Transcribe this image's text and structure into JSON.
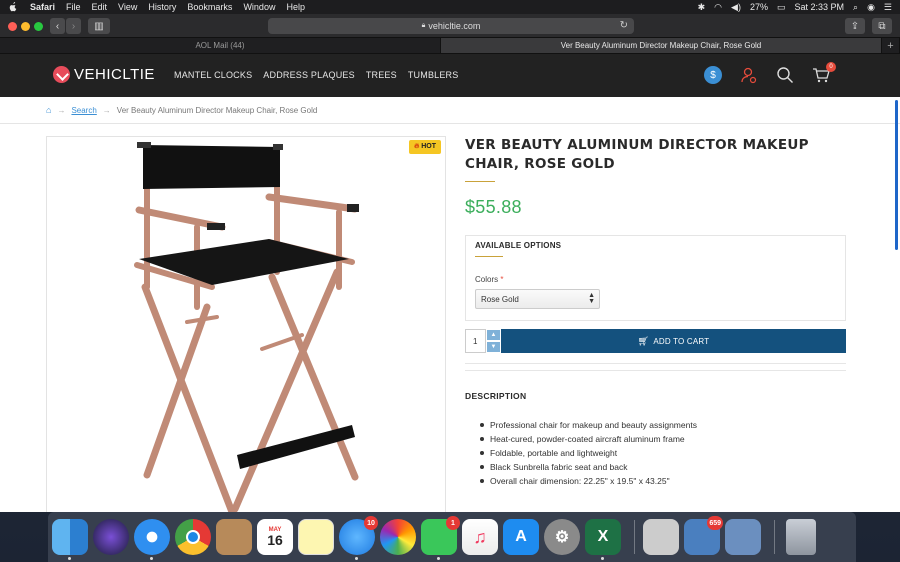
{
  "menubar": {
    "app": "Safari",
    "menus": [
      "File",
      "Edit",
      "View",
      "History",
      "Bookmarks",
      "Window",
      "Help"
    ],
    "battery": "27%",
    "clock": "Sat 2:33 PM"
  },
  "browser": {
    "url": "vehicltie.com",
    "tabs": [
      {
        "label": "AOL Mail (44)",
        "active": false
      },
      {
        "label": "Ver Beauty Aluminum Director Makeup Chair, Rose Gold",
        "active": true
      }
    ]
  },
  "site": {
    "logo": "VEHICLTIE",
    "nav": [
      "MANTEL CLOCKS",
      "ADDRESS PLAQUES",
      "TREES",
      "TUMBLERS"
    ],
    "currency_symbol": "$",
    "cart_count": "0"
  },
  "breadcrumb": {
    "link": "Search",
    "current": "Ver Beauty Aluminum Director Makeup Chair, Rose Gold"
  },
  "product": {
    "badge": "HOT",
    "title": "VER BEAUTY ALUMINUM DIRECTOR MAKEUP CHAIR, ROSE GOLD",
    "price": "$55.88",
    "options_heading": "AVAILABLE OPTIONS",
    "option_label": "Colors",
    "option_required": "*",
    "option_value": "Rose Gold",
    "quantity": "1",
    "add_to_cart": "ADD TO CART",
    "description_heading": "DESCRIPTION",
    "description_items": [
      "Professional chair for makeup and beauty assignments",
      "Heat-cured, powder-coated aircraft aluminum frame",
      "Foldable, portable and lightweight",
      "Black Sunbrella fabric seat and back",
      "Overall chair dimension: 22.25\" x 19.5\" x 43.25\""
    ]
  },
  "dock": {
    "calendar_month": "MAY",
    "calendar_day": "16",
    "messages_badge": "10",
    "facetime_badge": "1",
    "mail_badge": "659"
  },
  "colors": {
    "price_green": "#3cae5c",
    "add_to_cart_blue": "#14517e",
    "header_dark": "#222222",
    "hot_badge": "#f5c623"
  }
}
